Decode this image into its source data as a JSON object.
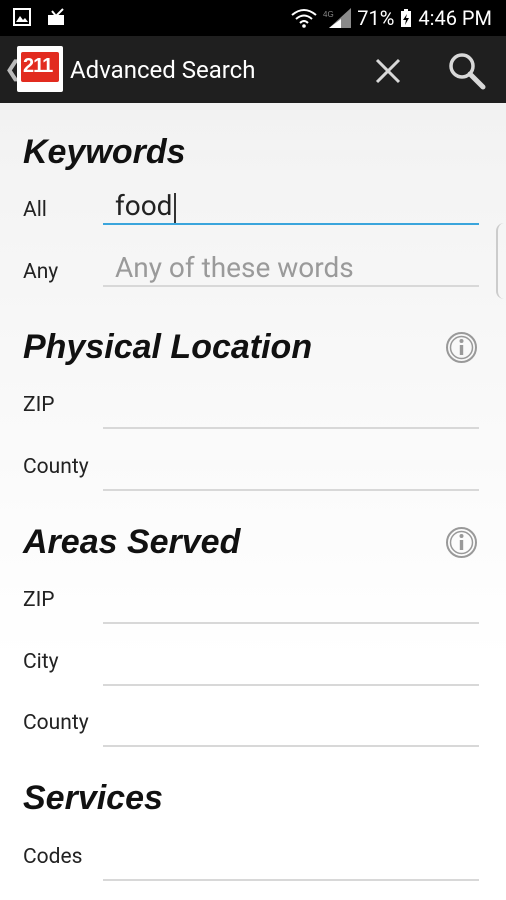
{
  "status_bar": {
    "battery_percent": "71%",
    "time": "4:46 PM"
  },
  "header": {
    "title": "Advanced Search",
    "logo_text": "211"
  },
  "keywords": {
    "title": "Keywords",
    "all_label": "All",
    "all_value": "food",
    "any_label": "Any",
    "any_placeholder": "Any of these words"
  },
  "physical_location": {
    "title": "Physical Location",
    "zip_label": "ZIP",
    "county_label": "County"
  },
  "areas_served": {
    "title": "Areas Served",
    "zip_label": "ZIP",
    "city_label": "City",
    "county_label": "County"
  },
  "services": {
    "title": "Services",
    "codes_label": "Codes"
  }
}
